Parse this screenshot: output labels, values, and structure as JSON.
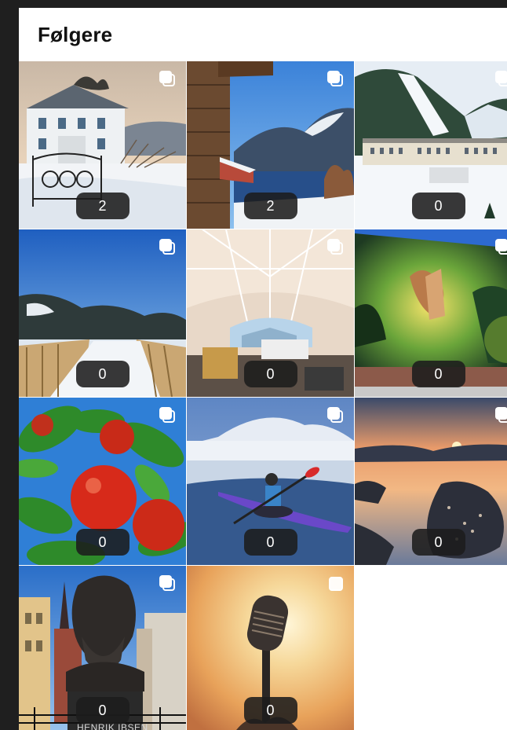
{
  "header": {
    "title": "Følgere"
  },
  "tiles": [
    {
      "name": "tile-snowy-house",
      "count": "2",
      "icon": "multiple-images-icon"
    },
    {
      "name": "tile-fjord-cabin",
      "count": "2",
      "icon": "multiple-images-icon"
    },
    {
      "name": "tile-ski-resort",
      "count": "0",
      "icon": "multiple-images-icon"
    },
    {
      "name": "tile-winter-boardwalk",
      "count": "0",
      "icon": "multiple-images-icon"
    },
    {
      "name": "tile-glass-dome",
      "count": "0",
      "icon": "multiple-images-icon"
    },
    {
      "name": "tile-forest-mural",
      "count": "0",
      "icon": "multiple-images-icon"
    },
    {
      "name": "tile-red-apples",
      "count": "0",
      "icon": "multiple-images-icon"
    },
    {
      "name": "tile-kayaker",
      "count": "0",
      "icon": "multiple-images-icon"
    },
    {
      "name": "tile-sunset-islands",
      "count": "0",
      "icon": "multiple-images-icon"
    },
    {
      "name": "tile-ibsen-statue",
      "count": "0",
      "caption": "HENRIK IBSEN",
      "icon": "multiple-images-icon"
    },
    {
      "name": "tile-vintage-microphone",
      "count": "0",
      "icon": "single-image-icon"
    }
  ],
  "colors": {
    "panel": "#ffffff",
    "background": "#1f1f1f",
    "badge": "#1c1c1c"
  }
}
